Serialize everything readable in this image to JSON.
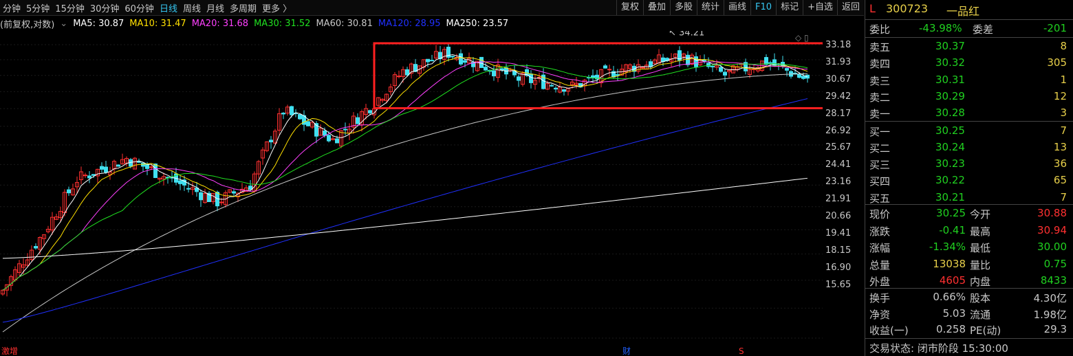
{
  "toolbar": {
    "periods": [
      "分钟",
      "5分钟",
      "15分钟",
      "30分钟",
      "60分钟",
      "日线",
      "周线",
      "月线",
      "多周期",
      "更多 〉"
    ],
    "active_period": "日线",
    "tools": [
      "复权",
      "叠加",
      "多股",
      "统计",
      "画线",
      "F10",
      "标记",
      "+自选",
      "返回"
    ]
  },
  "ma_bar": {
    "prefix": "(前复权,对数)",
    "items": [
      {
        "label": "MA5: 30.87",
        "color": "#ffffff"
      },
      {
        "label": "MA10: 31.47",
        "color": "#ffe000"
      },
      {
        "label": "MA20: 31.68",
        "color": "#ff40ff"
      },
      {
        "label": "MA30: 31.52",
        "color": "#20e020"
      },
      {
        "label": "MA60: 30.81",
        "color": "#c8c8c8"
      },
      {
        "label": "MA120: 28.95",
        "color": "#2030ff"
      },
      {
        "label": "MA250: 23.57",
        "color": "#ffffff"
      }
    ]
  },
  "yaxis": [
    "33.18",
    "31.93",
    "30.67",
    "29.42",
    "28.17",
    "26.92",
    "25.67",
    "24.41",
    "23.16",
    "21.91",
    "20.66",
    "19.41",
    "18.15",
    "16.90",
    "15.65"
  ],
  "annotations": {
    "high_label": "34.21",
    "bottom_left": "激增",
    "bottom_mid": "财",
    "bottom_right": "S"
  },
  "chart_data": {
    "type": "candlestick",
    "ylim": [
      15.65,
      34.21
    ],
    "scale": "log",
    "highlight_box": "consolidation range 28.2 - 33.3",
    "ma_values": {
      "MA5": 30.87,
      "MA10": 31.47,
      "MA20": 31.68,
      "MA30": 31.52,
      "MA60": 30.81,
      "MA120": 28.95,
      "MA250": 23.57
    }
  },
  "panel": {
    "marker": "L",
    "code": "300723",
    "name": "一品红",
    "weibi": {
      "label": "委比",
      "value": "-43.98%",
      "label2": "委差",
      "value2": "-201"
    },
    "asks": [
      {
        "label": "卖五",
        "price": "30.37",
        "vol": "8"
      },
      {
        "label": "卖四",
        "price": "30.32",
        "vol": "305"
      },
      {
        "label": "卖三",
        "price": "30.31",
        "vol": "1"
      },
      {
        "label": "卖二",
        "price": "30.29",
        "vol": "12"
      },
      {
        "label": "卖一",
        "price": "30.28",
        "vol": "3"
      }
    ],
    "bids": [
      {
        "label": "买一",
        "price": "30.25",
        "vol": "7"
      },
      {
        "label": "买二",
        "price": "30.24",
        "vol": "13"
      },
      {
        "label": "买三",
        "price": "30.23",
        "vol": "36"
      },
      {
        "label": "买四",
        "price": "30.22",
        "vol": "65"
      },
      {
        "label": "买五",
        "price": "30.21",
        "vol": "7"
      }
    ],
    "stats": [
      {
        "l1": "现价",
        "v1": "30.25",
        "c1": "#20d020",
        "l2": "今开",
        "v2": "30.88",
        "c2": "#ff3030"
      },
      {
        "l1": "涨跌",
        "v1": "-0.41",
        "c1": "#20d020",
        "l2": "最高",
        "v2": "30.94",
        "c2": "#ff3030"
      },
      {
        "l1": "涨幅",
        "v1": "-1.34%",
        "c1": "#20d020",
        "l2": "最低",
        "v2": "30.00",
        "c2": "#20d020"
      },
      {
        "l1": "总量",
        "v1": "13038",
        "c1": "#e8d04a",
        "l2": "量比",
        "v2": "0.75",
        "c2": "#20d020"
      },
      {
        "l1": "外盘",
        "v1": "4605",
        "c1": "#ff3030",
        "l2": "内盘",
        "v2": "8433",
        "c2": "#20d020"
      }
    ],
    "stats2": [
      {
        "l1": "换手",
        "v1": "0.66%",
        "l2": "股本",
        "v2": "4.30亿"
      },
      {
        "l1": "净资",
        "v1": "5.03",
        "l2": "流通",
        "v2": "1.98亿"
      },
      {
        "l1": "收益(一)",
        "v1": "0.258",
        "l2": "PE(动)",
        "v2": "29.3"
      }
    ],
    "status_label": "交易状态: 闭市阶段 15:30:00"
  },
  "colors": {
    "up": "#ff3030",
    "down": "#40e0f0",
    "accent": "#35c5f0",
    "box": "#ff2020"
  }
}
